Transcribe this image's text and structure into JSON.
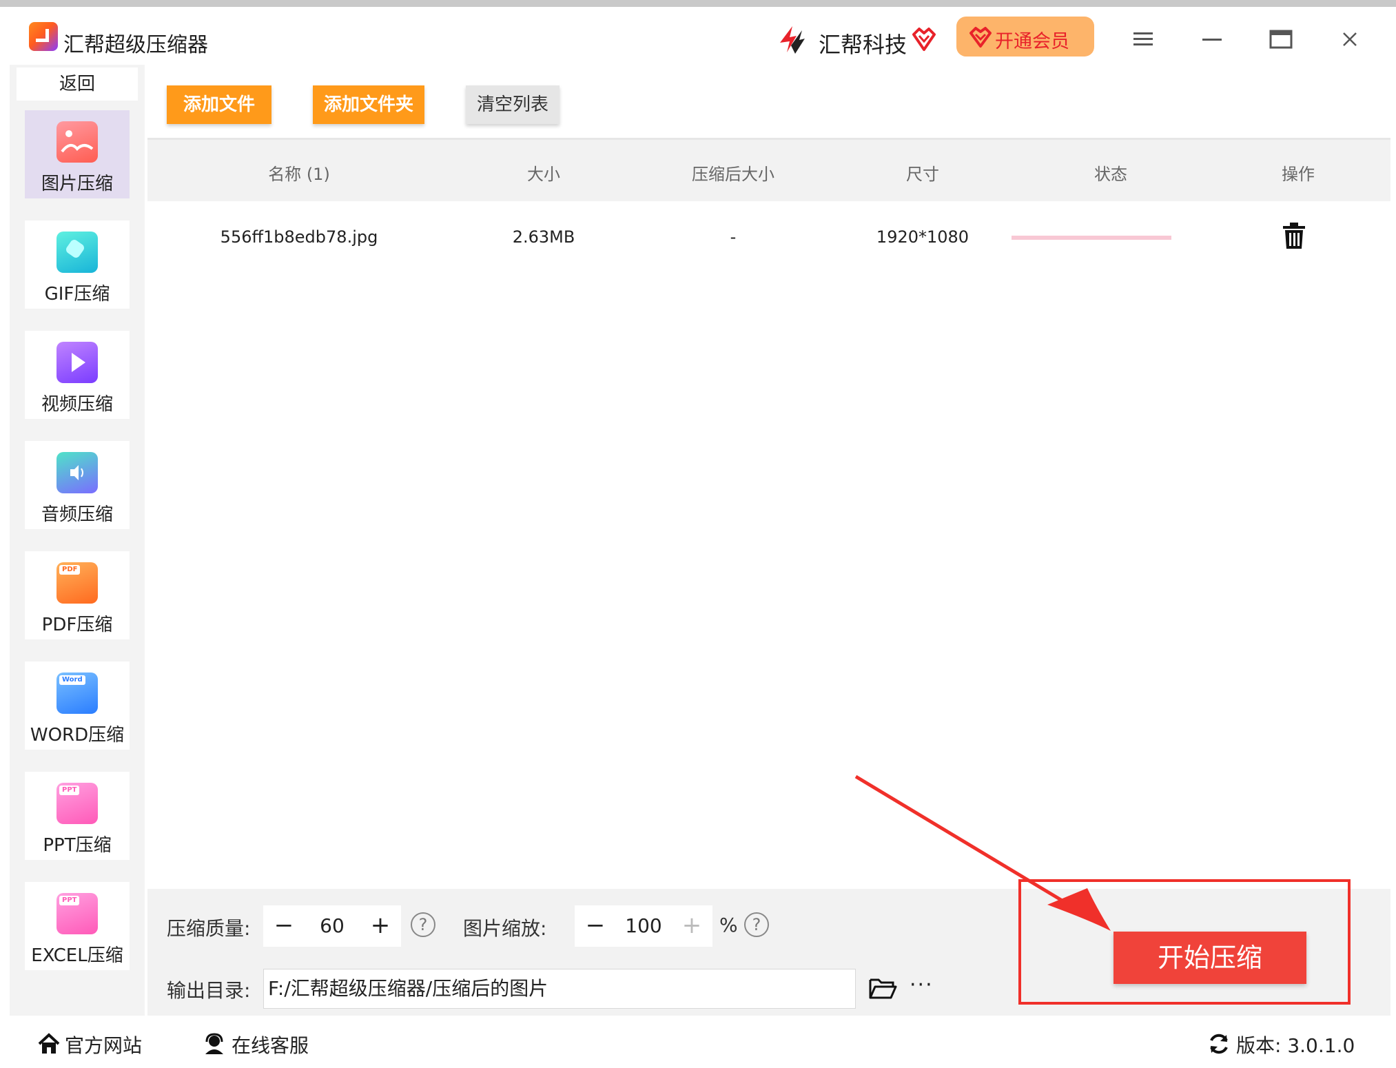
{
  "app": {
    "title": "汇帮超级压缩器",
    "brand_name": "汇帮科技",
    "vip_label": "开通会员"
  },
  "sidebar": {
    "back_label": "返回",
    "items": [
      {
        "label": "图片压缩",
        "icon": "image-icon",
        "active": true
      },
      {
        "label": "GIF压缩",
        "icon": "gif-icon",
        "active": false
      },
      {
        "label": "视频压缩",
        "icon": "video-play-icon",
        "active": false
      },
      {
        "label": "音频压缩",
        "icon": "audio-speaker-icon",
        "active": false
      },
      {
        "label": "PDF压缩",
        "icon": "pdf-folder-icon",
        "active": false,
        "tag": "PDF"
      },
      {
        "label": "WORD压缩",
        "icon": "word-folder-icon",
        "active": false,
        "tag": "Word"
      },
      {
        "label": "PPT压缩",
        "icon": "ppt-folder-icon",
        "active": false,
        "tag": "PPT"
      },
      {
        "label": "EXCEL压缩",
        "icon": "excel-folder-icon",
        "active": false,
        "tag": "PPT"
      }
    ]
  },
  "toolbar": {
    "add_file": "添加文件",
    "add_folder": "添加文件夹",
    "clear_list": "清空列表"
  },
  "table": {
    "columns": [
      "名称 (1)",
      "大小",
      "压缩后大小",
      "尺寸",
      "状态",
      "操作"
    ],
    "rows": [
      {
        "name": "556ff1b8edb78.jpg",
        "size": "2.63MB",
        "compressed_size": "-",
        "dimensions": "1920*1080",
        "status_progress": 0
      }
    ]
  },
  "settings": {
    "quality_label": "压缩质量:",
    "quality_value": "60",
    "scale_label": "图片缩放:",
    "scale_value": "100",
    "scale_unit": "%",
    "output_label": "输出目录:",
    "output_path": "F:/汇帮超级压缩器/压缩后的图片",
    "more": "···",
    "start_label": "开始压缩"
  },
  "statusbar": {
    "website": "官方网站",
    "support": "在线客服",
    "version": "版本: 3.0.1.0"
  },
  "colors": {
    "accent_orange": "#ff9a1a",
    "start_red": "#f0433a",
    "vip_bg": "#fdb46a",
    "annotation_red": "#f0302a"
  }
}
